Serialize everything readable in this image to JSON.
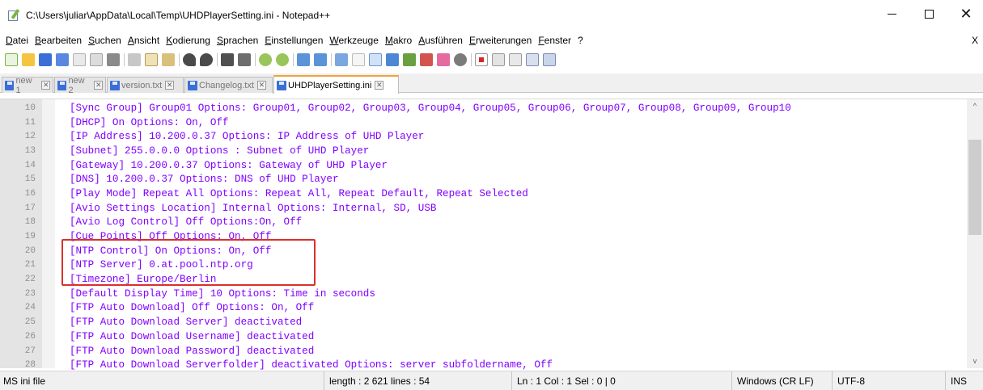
{
  "window": {
    "title": "C:\\Users\\juliar\\AppData\\Local\\Temp\\UHDPlayerSetting.ini - Notepad++",
    "minimize": "",
    "maximize": "",
    "close": "✕"
  },
  "menu": {
    "items": [
      "Datei",
      "Bearbeiten",
      "Suchen",
      "Ansicht",
      "Kodierung",
      "Sprachen",
      "Einstellungen",
      "Werkzeuge",
      "Makro",
      "Ausführen",
      "Erweiterungen",
      "Fenster",
      "?"
    ],
    "close_doc": "X"
  },
  "tabs": [
    {
      "label": "new 1",
      "close": "✕"
    },
    {
      "label": "new 2",
      "close": "✕"
    },
    {
      "label": "version.txt",
      "close": "✕"
    },
    {
      "label": "Changelog.txt",
      "close": "✕"
    },
    {
      "label": "UHDPlayerSetting.ini",
      "close": "✕"
    }
  ],
  "editor": {
    "lines": [
      {
        "n": "10",
        "text": "[Sync Group] Group01 Options: Group01, Group02, Group03, Group04, Group05, Group06, Group07, Group08, Group09, Group10"
      },
      {
        "n": "11",
        "text": "[DHCP] On Options: On, Off"
      },
      {
        "n": "12",
        "text": "[IP Address] 10.200.0.37 Options: IP Address of UHD Player"
      },
      {
        "n": "13",
        "text": "[Subnet] 255.0.0.0 Options : Subnet of UHD Player"
      },
      {
        "n": "14",
        "text": "[Gateway] 10.200.0.37 Options: Gateway of UHD Player"
      },
      {
        "n": "15",
        "text": "[DNS] 10.200.0.37 Options: DNS of UHD Player"
      },
      {
        "n": "16",
        "text": "[Play Mode] Repeat All Options: Repeat All, Repeat Default, Repeat Selected"
      },
      {
        "n": "17",
        "text": "[Avio Settings Location] Internal Options: Internal, SD, USB"
      },
      {
        "n": "18",
        "text": "[Avio Log Control] Off Options:On, Off"
      },
      {
        "n": "19",
        "text": "[Cue Points] Off Options: On, Off"
      },
      {
        "n": "20",
        "text": "[NTP Control] On Options: On, Off"
      },
      {
        "n": "21",
        "text": "[NTP Server] 0.at.pool.ntp.org"
      },
      {
        "n": "22",
        "text": "[Timezone] Europe/Berlin"
      },
      {
        "n": "23",
        "text": "[Default Display Time] 10 Options: Time in seconds"
      },
      {
        "n": "24",
        "text": "[FTP Auto Download] Off Options: On, Off"
      },
      {
        "n": "25",
        "text": "[FTP Auto Download Server] deactivated"
      },
      {
        "n": "26",
        "text": "[FTP Auto Download Username] deactivated"
      },
      {
        "n": "27",
        "text": "[FTP Auto Download Password] deactivated"
      },
      {
        "n": "28",
        "text": "[FTP Auto Download Serverfolder] deactivated Options: server subfoldername, Off"
      }
    ]
  },
  "scrollbar": {
    "up": "^",
    "down": "v"
  },
  "status": {
    "file_type": "MS ini file",
    "length_lines": "length : 2 621    lines : 54",
    "position": "Ln : 1    Col : 1    Sel : 0 | 0",
    "eol": "Windows (CR LF)",
    "encoding": "UTF-8",
    "mode": "INS"
  },
  "colors": {
    "text": "#8000ff",
    "highlight_border": "#d9302c",
    "active_tab_accent": "#f2a23b"
  }
}
